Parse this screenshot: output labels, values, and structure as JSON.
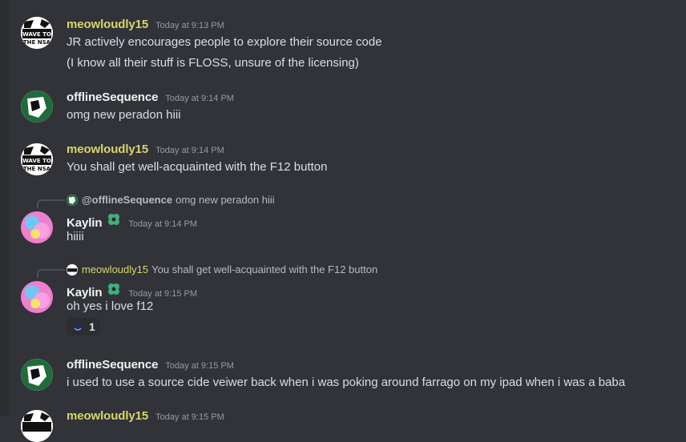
{
  "messages": [
    {
      "user": "meowloudly15",
      "time": "Today at 9:13 PM",
      "avatar_text": "WAVE TO THE NSA",
      "lines": [
        "JR actively encourages people to explore their source code",
        "(I know all their stuff is FLOSS, unsure of the licensing)"
      ]
    },
    {
      "user": "offlineSequence",
      "time": "Today at 9:14 PM",
      "lines": [
        "omg new peradon hiii"
      ]
    },
    {
      "user": "meowloudly15",
      "time": "Today at 9:14 PM",
      "avatar_text": "WAVE TO THE NSA",
      "lines": [
        "You shall get well-acquainted with the F12 button"
      ]
    },
    {
      "reply": {
        "name": "@offlineSequence",
        "text": "omg new peradon hiii"
      },
      "user": "Kaylin",
      "time": "Today at 9:14 PM",
      "lines": [
        "hiiii"
      ]
    },
    {
      "reply": {
        "name": "meowloudly15",
        "text": "You shall get well-acquainted with the F12 button"
      },
      "user": "Kaylin",
      "time": "Today at 9:15 PM",
      "lines": [
        "oh yes i love f12"
      ],
      "reaction": {
        "count": "1"
      }
    },
    {
      "user": "offlineSequence",
      "time": "Today at 9:15 PM",
      "lines": [
        "i used to use a source cide veiwer back when i was poking around farrago on my ipad when i was a baba"
      ]
    },
    {
      "user": "meowloudly15",
      "time": "Today at 9:15 PM"
    }
  ]
}
